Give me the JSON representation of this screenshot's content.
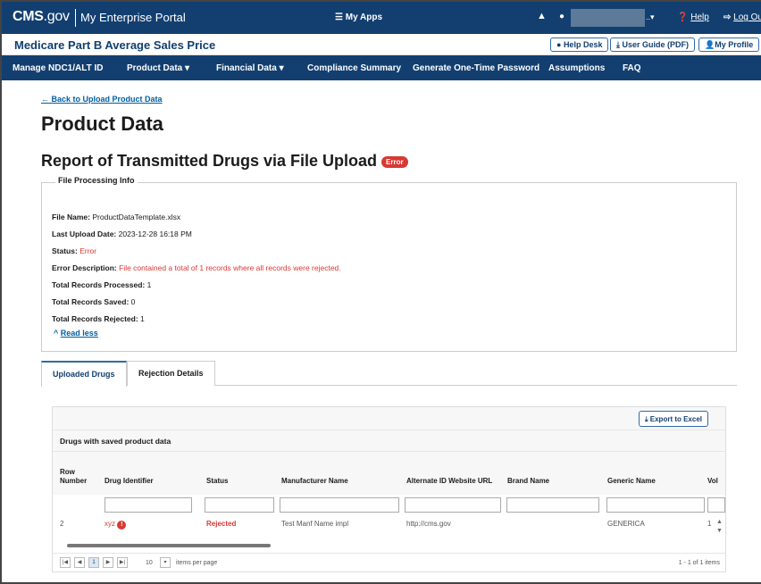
{
  "topbar": {
    "brand_bold": "CMS",
    "brand_gov": ".gov",
    "portal": "My Enterprise Portal",
    "apps": "☰ My Apps",
    "bell": "▲",
    "user_icon": "●",
    "user_suffix": "..▾",
    "help": "Help",
    "logout": "Log Out",
    "help_icon": "❓",
    "logout_icon": "⇨"
  },
  "subheader": {
    "title": "Medicare Part B Average Sales Price",
    "help_desk": "Help Desk",
    "user_guide": "User Guide (PDF)",
    "my_profile": "My Profile"
  },
  "nav": {
    "items": [
      "Manage NDC1/ALT ID",
      "Product Data ▾",
      "Financial Data ▾",
      "Compliance Summary",
      "Generate One-Time Password",
      "Assumptions",
      "FAQ"
    ]
  },
  "page": {
    "back_link": "← Back to Upload Product Data",
    "title": "Product Data",
    "subtitle": "Report of Transmitted Drugs via File Upload",
    "status_badge": "Error"
  },
  "file_info": {
    "legend": "File Processing Info",
    "file_name_label": "File Name:",
    "file_name": "ProductDataTemplate.xlsx",
    "upload_date_label": "Last Upload Date:",
    "upload_date": "2023-12-28 16:18 PM",
    "status_label": "Status:",
    "status": "Error",
    "error_desc_label": "Error Description:",
    "error_desc": "File contained a total of 1 records where all records were rejected.",
    "processed_label": "Total Records Processed:",
    "processed": "1",
    "saved_label": "Total Records Saved:",
    "saved": "0",
    "rejected_label": "Total Records Rejected:",
    "rejected": "1",
    "read_less": "Read less"
  },
  "tabs": [
    "Uploaded Drugs",
    "Rejection Details"
  ],
  "grid": {
    "export": "Export to Excel",
    "caption": "Drugs with saved product data",
    "headers": [
      "Row",
      "Number",
      "Drug Identifier",
      "Status",
      "Manufacturer Name",
      "Alternate ID Website URL",
      "Brand Name",
      "Generic Name",
      "Vol"
    ],
    "row": {
      "number": "2",
      "drug_id": "xyz",
      "status": "Rejected",
      "manufacturer": "Test Manf Name impl",
      "url": "http://cms.gov",
      "brand": "",
      "generic": "GENERICA",
      "vol": "1"
    },
    "pager": {
      "page": "1",
      "page_size": "10",
      "items_per_page": "items per page",
      "info": "1 - 1 of 1 items"
    }
  },
  "colors": {
    "navy": "#123f70",
    "error": "#d83933",
    "link": "#005ea2"
  }
}
